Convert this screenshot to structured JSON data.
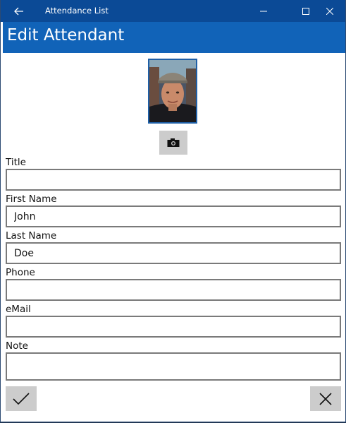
{
  "window": {
    "title": "Attendance List"
  },
  "header": {
    "title": "Edit Attendant"
  },
  "form": {
    "fields": [
      {
        "label": "Title",
        "value": ""
      },
      {
        "label": "First Name",
        "value": "John"
      },
      {
        "label": "Last Name",
        "value": "Doe"
      },
      {
        "label": "Phone",
        "value": ""
      },
      {
        "label": "eMail",
        "value": ""
      },
      {
        "label": "Note",
        "value": ""
      }
    ]
  },
  "icons": {
    "back": "back-arrow-icon",
    "minimize": "minimize-icon",
    "maximize": "maximize-icon",
    "close": "close-icon",
    "camera": "camera-icon",
    "accept": "checkmark-icon",
    "cancel": "x-icon"
  },
  "colors": {
    "titlebar": "#0b4a96",
    "header": "#1163b8",
    "button": "#cccccc",
    "input_border": "#7a7a7a"
  }
}
